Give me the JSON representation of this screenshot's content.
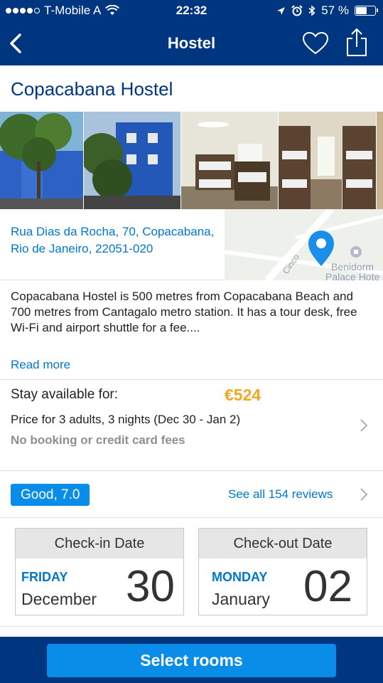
{
  "status_bar": {
    "carrier": "T-Mobile A",
    "time": "22:32",
    "battery": "57 %",
    "battery_level": 0.57,
    "icons": [
      "signal-dots",
      "wifi-icon",
      "location-arrow-icon",
      "alarm-icon",
      "bluetooth-icon",
      "battery-icon"
    ]
  },
  "nav": {
    "title": "Hostel",
    "icons": [
      "chevron-left-icon",
      "heart-icon",
      "share-icon"
    ]
  },
  "hotel": {
    "name": "Copacabana Hostel",
    "address_line1": "Rua Dias da Rocha, 70, Copacabana,",
    "address_line2": "Rio de Janeiro, 22051-020",
    "map_label_line1": "Benidorm",
    "map_label_line2": "Palace Hote",
    "map_street": "Cinco",
    "description": "Copacabana Hostel is 500 metres from Copacabana Beach and 700 metres from Cantagalo metro station. It has a tour desk, free Wi-Fi and airport shuttle for a fee....",
    "read_more": "Read more"
  },
  "stay": {
    "label": "Stay available for:",
    "price": "€524",
    "detail": "Price for 3 adults, 3 nights (Dec 30 - Jan 2)",
    "fees": "No booking or credit card fees"
  },
  "reviews": {
    "score": "Good, 7.0",
    "link": "See all 154 reviews"
  },
  "checkin": {
    "header": "Check-in Date",
    "weekday": "FRIDAY",
    "month": "December",
    "day": "30"
  },
  "checkout": {
    "header": "Check-out Date",
    "weekday": "MONDAY",
    "month": "January",
    "day": "02"
  },
  "cta": {
    "label": "Select rooms"
  },
  "colors": {
    "brand_navy": "#003580",
    "accent_blue": "#0a8de8",
    "link_blue": "#0077cc",
    "price_orange": "#f5a623"
  }
}
